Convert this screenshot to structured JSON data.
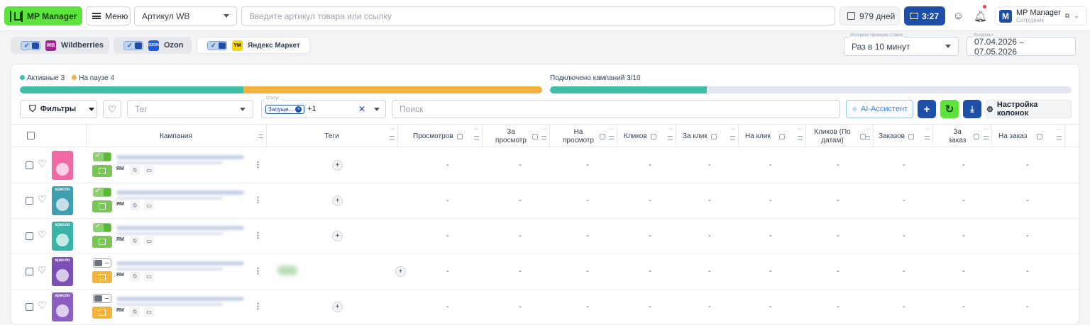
{
  "topbar": {
    "logo_label": "MP Manager",
    "menu_label": "Меню",
    "article_select": "Артикул WB",
    "search_placeholder": "Введите артикул товара или ссылку",
    "days_label": "979 дней",
    "timer_label": "3:27",
    "account_logo": "M",
    "account_name": "MP Manager",
    "account_role": "Сотрудник"
  },
  "marketplaces": [
    {
      "label": "Wildberries",
      "badge": "WB",
      "color": "#a12493"
    },
    {
      "label": "Ozon",
      "badge": "OZON",
      "color": "#1b5de0"
    },
    {
      "label": "Яндекс Маркет",
      "badge": "YM",
      "color": "#f9d800"
    }
  ],
  "interval": {
    "legend": "Интервал проверки ставок",
    "value": "Раз в 10 минут"
  },
  "period": {
    "legend": "Интервал",
    "value": "07.04.2026 – 07.05.2026"
  },
  "stats": {
    "active_label": "Активные 3",
    "paused_label": "На паузе 4",
    "active_count": 3,
    "paused_count": 4,
    "connected_label": "Подключено кампаний 3/10",
    "connected_fraction": 0.3,
    "colors": {
      "active": "#3fbfa8",
      "paused": "#f4b23d",
      "connected": "#3fbfa8"
    }
  },
  "toolbar": {
    "filters_label": "Фильтры",
    "tag_placeholder": "Тег",
    "status_legend": "Статус",
    "status_chip": "Запуще...",
    "status_more": "+1",
    "search_placeholder": "Поиск",
    "ai_label": "AI-Ассистент",
    "columns_label": "Настройка колонок"
  },
  "columns": {
    "campaign": "Кампания",
    "tags": "Теги",
    "views": "Просмотров",
    "per_view": "За просмотр",
    "per_view_2": "На просмотр",
    "clicks": "Кликов",
    "per_click": "За клик",
    "per_click_2": "На клик",
    "clicks_by_dates": "Кликов (По датам)",
    "orders": "Заказов",
    "per_order": "За заказ",
    "per_order_2": "На заказ"
  },
  "rows": [
    {
      "thumb_label": "",
      "thumb_color": "#f06aa5",
      "enabled": true,
      "state": "running",
      "ym": "ЯМ",
      "tag": false,
      "dash": "-"
    },
    {
      "thumb_label": "крeсло",
      "thumb_color": "#3f9fb1",
      "enabled": true,
      "state": "running",
      "ym": "ЯМ",
      "tag": false,
      "dash": "-"
    },
    {
      "thumb_label": "крeсло",
      "thumb_color": "#39b3a6",
      "enabled": true,
      "state": "running",
      "ym": "ЯМ",
      "tag": false,
      "dash": "-"
    },
    {
      "thumb_label": "крeсло",
      "thumb_color": "#7a4fb6",
      "enabled": false,
      "state": "paused",
      "ym": "ЯМ",
      "tag": true,
      "dash": "-"
    },
    {
      "thumb_label": "крeсло",
      "thumb_color": "#8c5ec2",
      "enabled": false,
      "state": "paused",
      "ym": "ЯМ",
      "tag": false,
      "dash": "-"
    }
  ]
}
